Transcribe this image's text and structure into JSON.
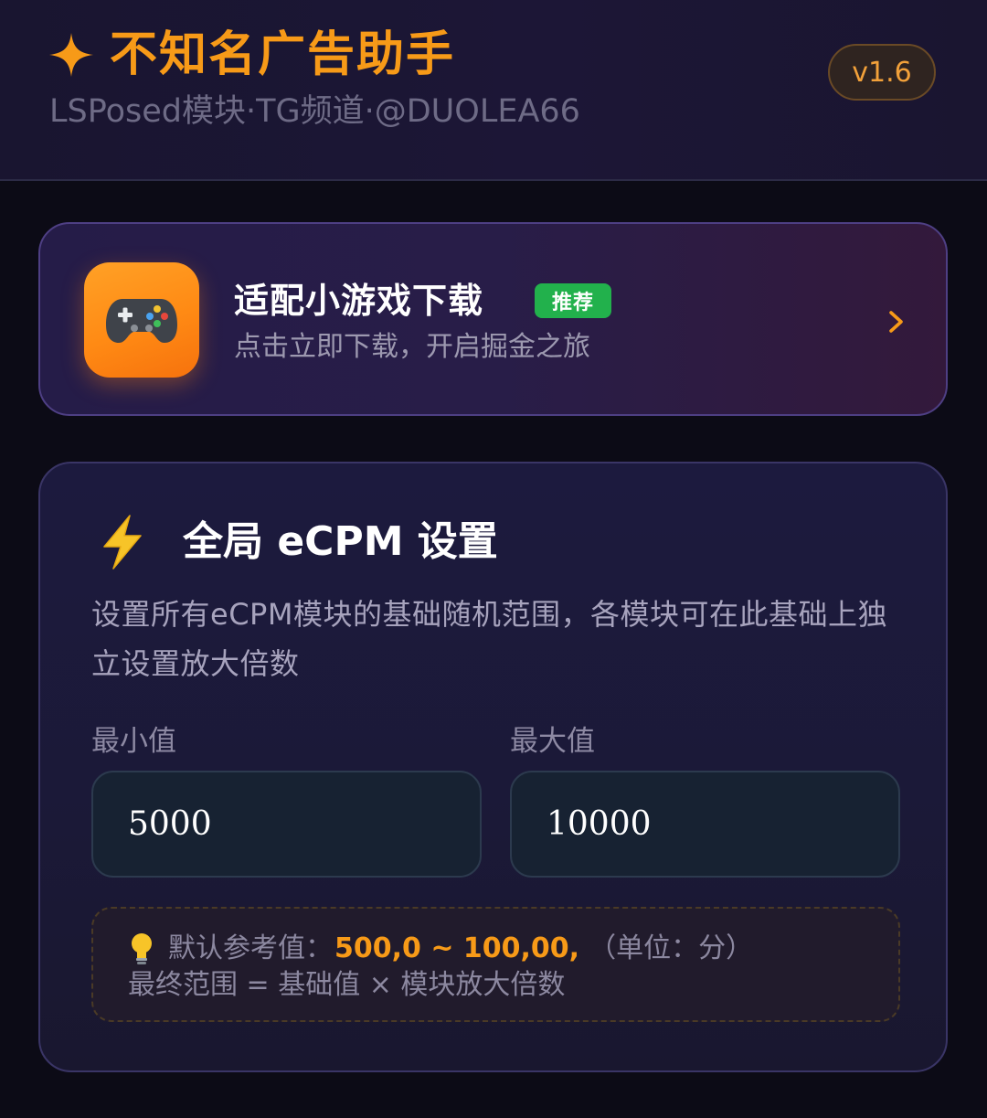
{
  "header": {
    "title": "不知名广告助手",
    "subtitle": "LSPosed模块·TG频道·@DUOLEA66",
    "version": "v1.6",
    "icon": "sparkle-icon"
  },
  "promo": {
    "title": "适配小游戏下载",
    "badge": "推荐",
    "subtitle": "点击立即下载，开启掘金之旅",
    "icon": "gamepad-icon",
    "action_icon": "chevron-right-icon"
  },
  "ecpm_settings": {
    "icon": "lightning-icon",
    "title": "全局 eCPM 设置",
    "description": "设置所有eCPM模块的基础随机范围，各模块可在此基础上独立设置放大倍数",
    "min": {
      "label": "最小值",
      "value": "5000"
    },
    "max": {
      "label": "最大值",
      "value": "10000"
    },
    "hint": {
      "icon": "lightbulb-icon",
      "label": "默认参考值：",
      "value": "500,0 ~ 100,00,",
      "unit": "（单位：分）",
      "formula": "最终范围 = 基础值 × 模块放大倍数"
    }
  },
  "colors": {
    "accent_orange": "#f79a18",
    "badge_green": "#22b14c",
    "background": "#0c0b16"
  }
}
